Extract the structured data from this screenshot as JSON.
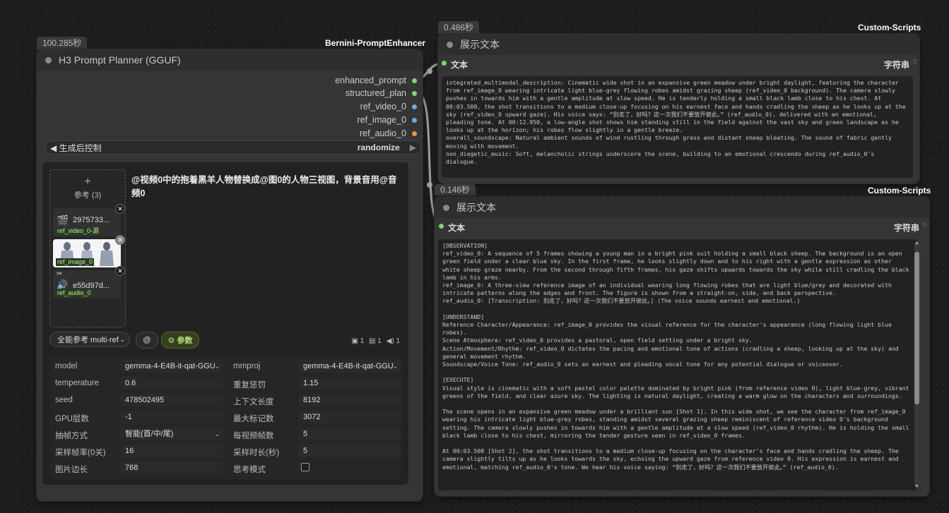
{
  "node1": {
    "time": "100.285秒",
    "source": "Bernini-PromptEnhancer",
    "title": "H3 Prompt Planner (GGUF)",
    "outputs": [
      {
        "label": "enhanced_prompt",
        "color": "#7bd96d"
      },
      {
        "label": "structured_plan",
        "color": "#7bd96d"
      },
      {
        "label": "ref_video_0",
        "color": "#6fa8e8"
      },
      {
        "label": "ref_image_0",
        "color": "#6fa8e8"
      },
      {
        "label": "ref_audio_0",
        "color": "#e8964e"
      }
    ],
    "control_left": "◀ 生成后控制",
    "control_value": "randomize",
    "control_right": "▶",
    "prompt": "@视频0中的抱着黑羊人物替换成@图0的人物三视图，背景音用@音频0",
    "refs_add": "+",
    "refs_label": "参考 (3)",
    "refs": [
      {
        "name": "2975733...",
        "tag": "ref_video_0-源",
        "icon": "video-icon",
        "glyph": "🎬"
      },
      {
        "name": "",
        "tag": "ref_image_0",
        "icon": "image-icon",
        "glyph": ""
      },
      {
        "name": "e55d97d...",
        "tag": "ref_audio_0",
        "icon": "audio-icon",
        "glyph": "🔊"
      }
    ],
    "mode_select": "全能参考 multi-ref",
    "at_button": "@",
    "params_button": "⚙ 参数",
    "counts": {
      "image": "1",
      "video": "1",
      "audio": "1"
    },
    "params_left": [
      {
        "label": "model",
        "value": "gemma-4-E4B-it-qat-GGU",
        "select": true
      },
      {
        "label": "temperature",
        "value": "0.6"
      },
      {
        "label": "seed",
        "value": "478502495"
      },
      {
        "label": "GPU层数",
        "value": "-1"
      },
      {
        "label": "抽帧方式",
        "value": "智能(首/中/尾)",
        "select": true
      },
      {
        "label": "采样帧率(0关)",
        "value": "16"
      },
      {
        "label": "图片边长",
        "value": "768"
      }
    ],
    "params_right": [
      {
        "label": "mmproj",
        "value": "gemma-4-E4B-it-qat-GGU",
        "select": true
      },
      {
        "label": "重复惩罚",
        "value": "1.15"
      },
      {
        "label": "上下文长度",
        "value": "8192"
      },
      {
        "label": "最大标记数",
        "value": "3072"
      },
      {
        "label": "每视频帧数",
        "value": "5"
      },
      {
        "label": "采样时长(秒)",
        "value": "5"
      },
      {
        "label": "思考模式",
        "value": ""
      }
    ]
  },
  "node2": {
    "time": "0.486秒",
    "source": "Custom-Scripts",
    "title": "展示文本",
    "input_label": "文本",
    "type_label": "字符串",
    "text": "integrated_multimodal_description: Cinematic wide shot in an expansive green meadow under bright daylight, featuring the character from ref_image_0 wearing intricate light blue-grey flowing robes amidst grazing sheep (ref_video_0 background). The camera slowly pushes in towards him with a gentle amplitude at slow speed. He is tenderly holding a small black lamb close to his chest. At 00:03.500, the shot transitions to a medium close-up focusing on his earnest face and hands cradling the sheep as he looks up at the sky (ref_video_0 upward gaze). His voice says: “别走了，好吗？这一次我们不要放开彼此。” (ref_audio_0), delivered with an emotional, pleading tone. At 00:12.950, a low-angle shot shows him standing still in the field against the vast sky and green landscape as he looks up at the horizon; his robes flow slightly in a gentle breeze.\noverall_soundscape: Natural ambient sounds of wind rustling through grass and distant sheep bleating. The sound of fabric gently moving with movement.\nnon_diegetic_music: Soft, melancholic strings underscore the scene, building to an emotional crescendo during ref_audio_0's dialogue."
  },
  "node3": {
    "time": "0.146秒",
    "source": "Custom-Scripts",
    "title": "展示文本",
    "input_label": "文本",
    "type_label": "字符串",
    "text": "[OBSERVATION]\nref_video_0: A sequence of 5 frames showing a young man in a bright pink suit holding a small black sheep. The background is an open green field under a clear blue sky. In the first frame, he looks slightly down and to his right with a gentle expression as other white sheep graze nearby. From the second through fifth frames, his gaze shifts upwards towards the sky while still cradling the black lamb in his arms.\nref_image_0: A three-view reference image of an individual wearing long flowing robes that are light blue/grey and decorated with intricate patterns along the edges and front. The figure is shown from a straight-on, side, and back perspective.\nref_audio_0: [Transcription: 别走了，好吗？这一次我们不要放开彼此。] (The voice sounds earnest and emotional.)\n\n[UNDERSTAND]\nReference Character/Appearance: ref_image_0 provides the visual reference for the character's appearance (long flowing light blue robes).\nScene Atmosphere: ref_video_0 provides a pastoral, open field setting under a bright sky.\nAction/Movement/Rhythm: ref_video_0 dictates the pacing and emotional tone of actions (cradling a sheep, looking up at the sky) and general movement rhythm.\nSoundscape/Voice Tone: ref_audio_0 sets an earnest and pleading vocal tone for any potential dialogue or voiceover.\n\n[EXECUTE]\nVisual style is cinematic with a soft pastel color palette dominated by bright pink (from reference video 0), light blue-grey, vibrant greens of the field, and clear azure sky. The lighting is natural daylight, creating a warm glow on the characters and surroundings.\n\nThe scene opens in an expansive green meadow under a brilliant sun [Shot 1]. In this wide shot, we see the character from ref_image_0 wearing his intricate light blue-grey robes, standing amidst several grazing sheep reminiscent of reference video 0's background setting. The camera slowly pushes in towards him with a gentle amplitude at a slow speed (ref_video_0 rhythm). He is holding the small black lamb close to his chest, mirroring the tender gesture seen in ref_video_0 frames.\n\nAt 00:03.500 [Shot 2], the shot transitions to a medium close-up focusing on the character's face and hands cradling the sheep. The camera slightly tilts up as he looks towards the sky, echoing the upward gaze from reference video 0. His expression is earnest and emotional, matching ref_audio_0's tone. We hear his voice saying: “别走了，好吗？这一次我们不要放开彼此。” (ref_audio_0)."
  },
  "colors": {
    "green_port": "#7bd96d",
    "blue_port": "#6fa8e8",
    "orange_port": "#e8964e",
    "params_accent": "#b8e07a"
  }
}
